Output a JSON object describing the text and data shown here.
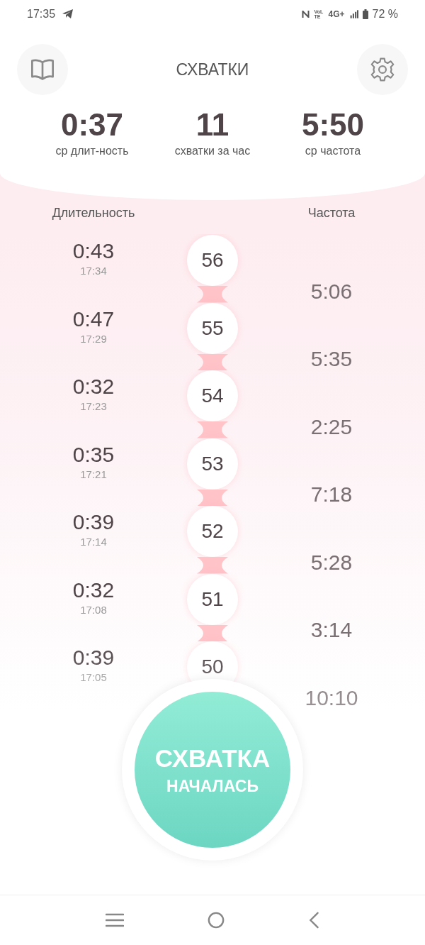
{
  "status_bar": {
    "time": "17:35",
    "volte": "VoLTE",
    "network": "4G+",
    "battery": "72 %"
  },
  "header": {
    "title": "СХВАТКИ"
  },
  "stats": [
    {
      "value": "0:37",
      "label": "ср длит-ность"
    },
    {
      "value": "11",
      "label": "схватки за час"
    },
    {
      "value": "5:50",
      "label": "ср частота"
    }
  ],
  "columns": {
    "duration": "Длительность",
    "frequency": "Частота"
  },
  "contractions": [
    {
      "number": "56",
      "duration": "0:43",
      "start": "17:34"
    },
    {
      "number": "55",
      "duration": "0:47",
      "start": "17:29"
    },
    {
      "number": "54",
      "duration": "0:32",
      "start": "17:23"
    },
    {
      "number": "53",
      "duration": "0:35",
      "start": "17:21"
    },
    {
      "number": "52",
      "duration": "0:39",
      "start": "17:14"
    },
    {
      "number": "51",
      "duration": "0:32",
      "start": "17:08"
    },
    {
      "number": "50",
      "duration": "0:39",
      "start": "17:05"
    }
  ],
  "intervals": [
    "5:06",
    "5:35",
    "2:25",
    "7:18",
    "5:28",
    "3:14",
    "10:10"
  ],
  "main_button": {
    "line_1": "СХВАТКА",
    "line_2": "НАЧАЛАСЬ"
  }
}
